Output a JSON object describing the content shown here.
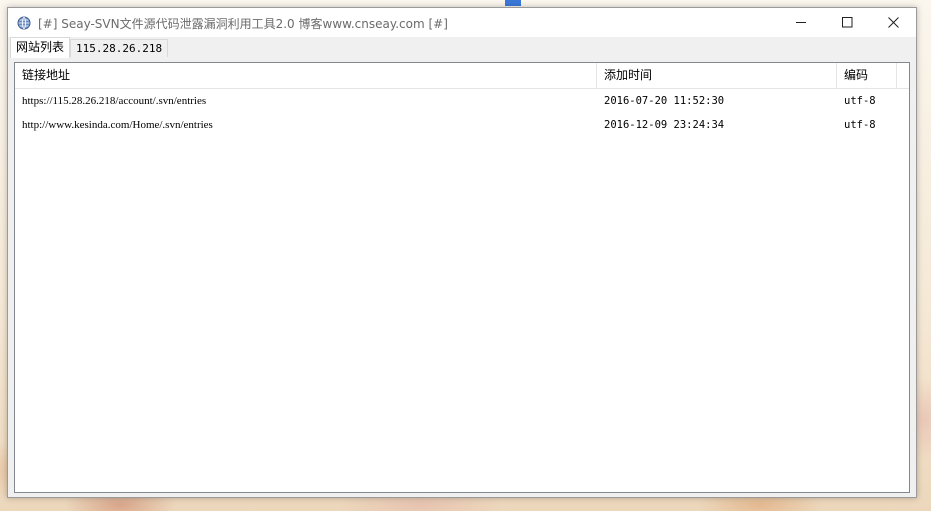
{
  "window": {
    "title": "[#] Seay-SVN文件源代码泄露漏洞利用工具2.0  博客www.cnseay.com [#]",
    "controls": {
      "minimize_icon": "minimize-icon",
      "maximize_icon": "maximize-icon",
      "close_icon": "close-icon"
    }
  },
  "tabs": [
    {
      "label": "网站列表",
      "active": true
    },
    {
      "label": "115.28.26.218",
      "active": false
    }
  ],
  "table": {
    "columns": [
      "链接地址",
      "添加时间",
      "编码"
    ],
    "rows": [
      {
        "url": "https://115.28.26.218/account/.svn/entries",
        "time": "2016-07-20 11:52:30",
        "encoding": "utf-8"
      },
      {
        "url": "http://www.kesinda.com/Home/.svn/entries",
        "time": "2016-12-09 23:24:34",
        "encoding": "utf-8"
      }
    ]
  },
  "colors": {
    "accent": "#3b78d8",
    "window_bg": "#ffffff",
    "panel_bg": "#f0f0f0"
  }
}
